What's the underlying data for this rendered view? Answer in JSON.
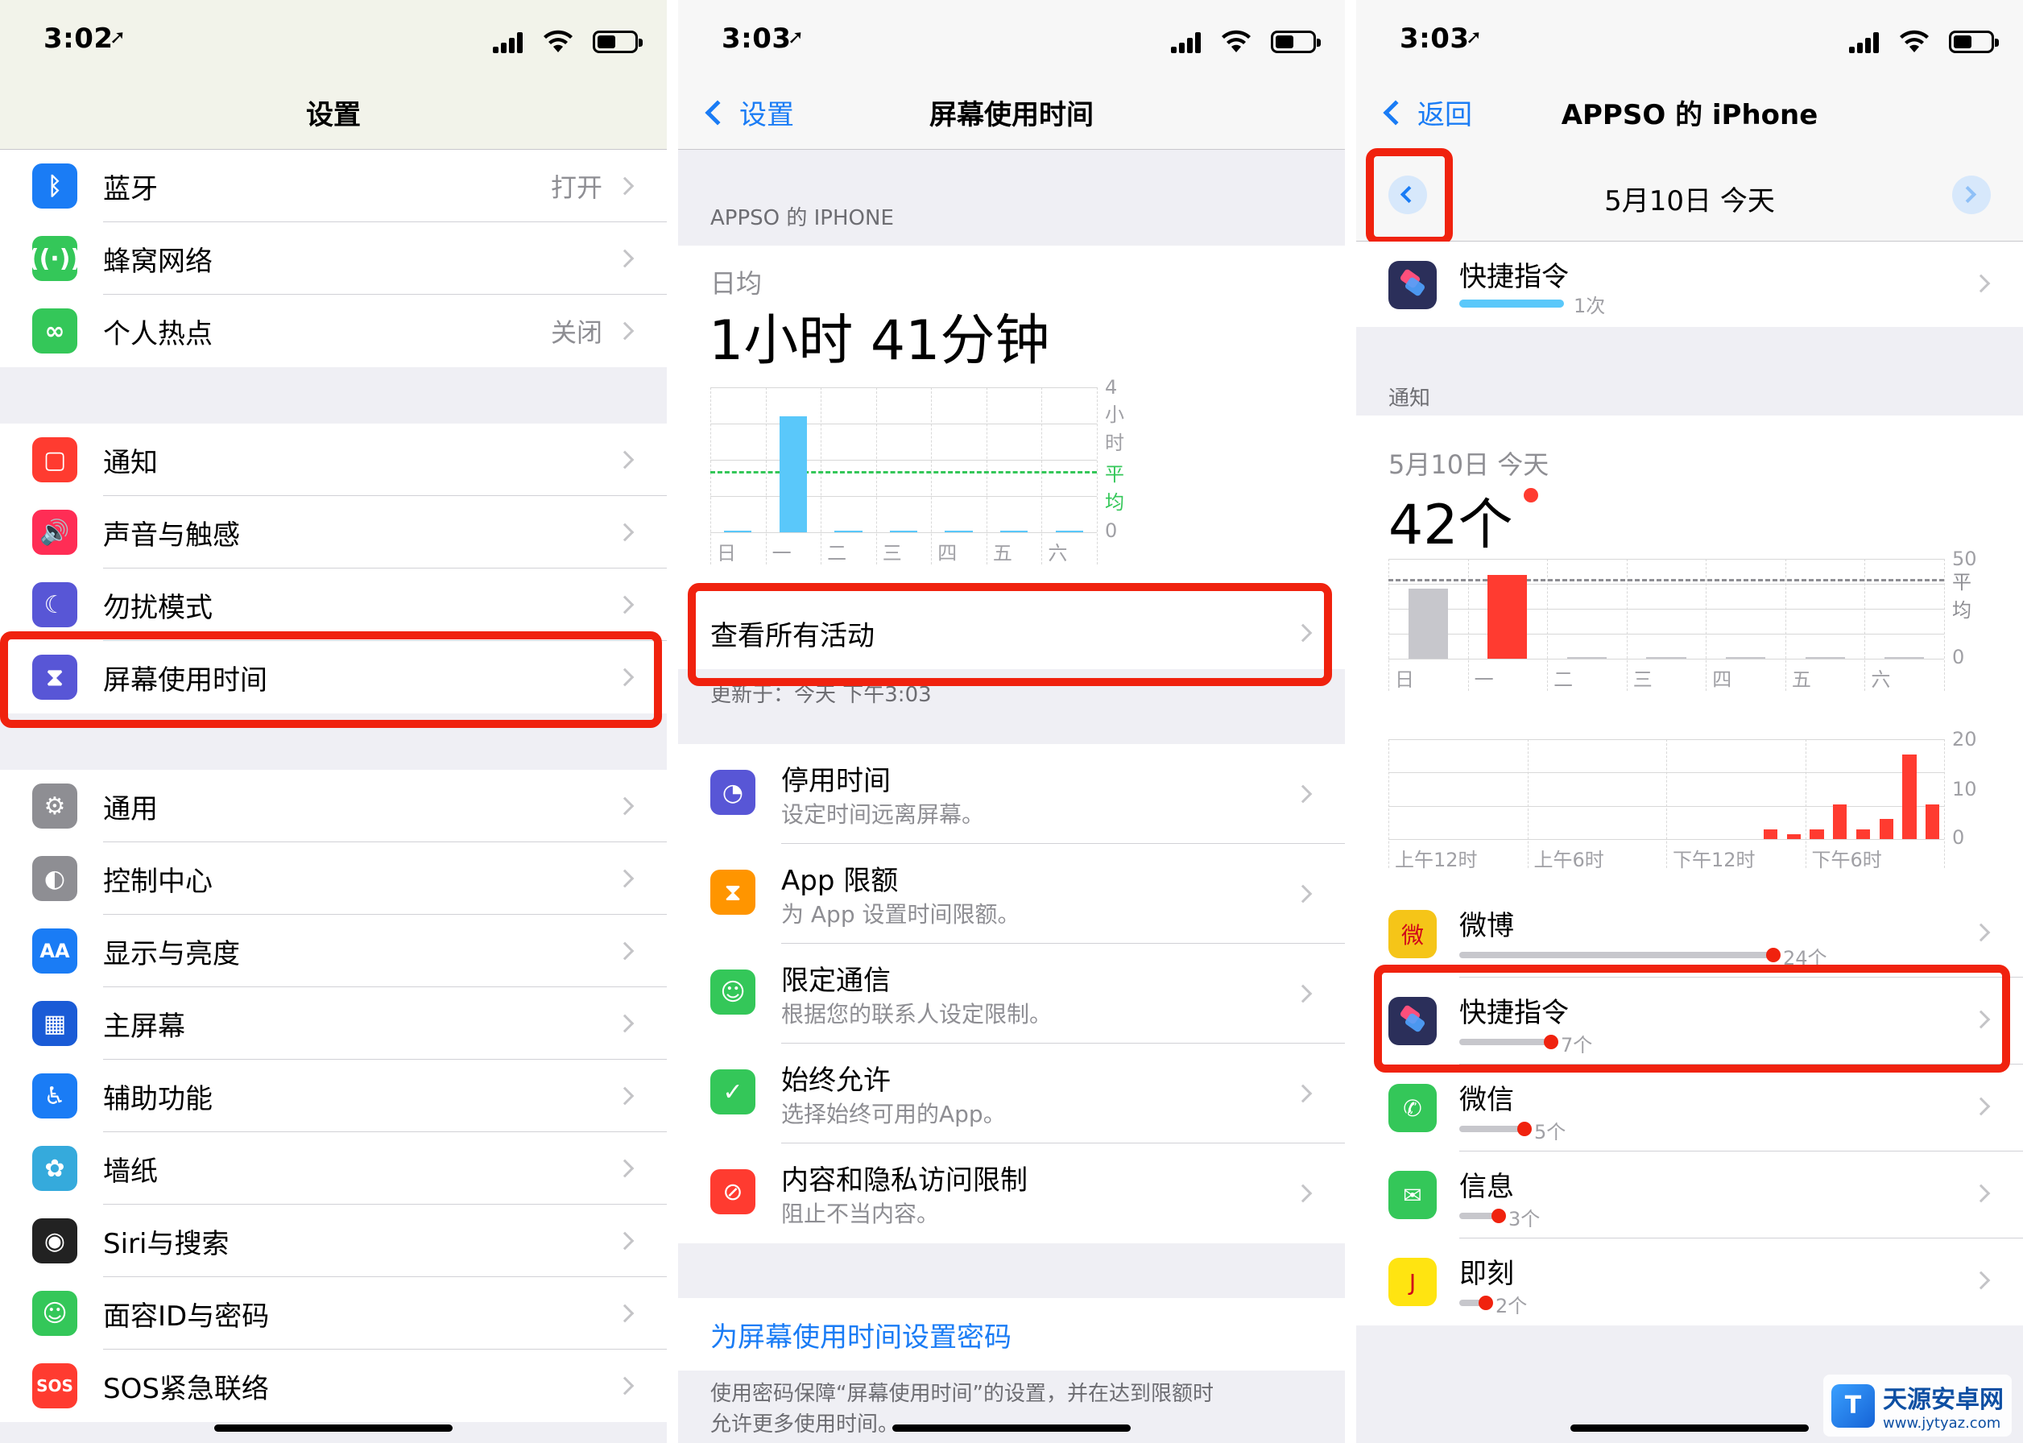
{
  "colors": {
    "accent": "#1a7cf5",
    "highlight": "#f0220e",
    "chart_blue": "#5ac8fa",
    "avg_green": "#34c759",
    "notify_red": "#ff3b30"
  },
  "status_bars": [
    {
      "time": "3:02"
    },
    {
      "time": "3:03"
    },
    {
      "time": "3:03"
    }
  ],
  "settings": {
    "title": "设置",
    "group1": [
      {
        "label": "蓝牙",
        "value": "打开",
        "icon": "bluetooth-icon",
        "color": "#1a7cf5"
      },
      {
        "label": "蜂窝网络",
        "value": "",
        "icon": "cellular-icon",
        "color": "#34c759"
      },
      {
        "label": "个人热点",
        "value": "关闭",
        "icon": "hotspot-icon",
        "color": "#34c759"
      }
    ],
    "group2": [
      {
        "label": "通知",
        "icon": "notifications-icon",
        "color": "#ff3b30"
      },
      {
        "label": "声音与触感",
        "icon": "sound-icon",
        "color": "#ff2d55"
      },
      {
        "label": "勿扰模式",
        "icon": "moon-icon",
        "color": "#5856d6"
      },
      {
        "label": "屏幕使用时间",
        "icon": "hourglass-icon",
        "color": "#5856d6"
      }
    ],
    "group3": [
      {
        "label": "通用",
        "icon": "gear-icon",
        "color": "#8e8e93"
      },
      {
        "label": "控制中心",
        "icon": "toggles-icon",
        "color": "#8e8e93"
      },
      {
        "label": "显示与亮度",
        "icon": "aa-icon",
        "color": "#1a7cf5"
      },
      {
        "label": "主屏幕",
        "icon": "home-grid-icon",
        "color": "#1a5bd6"
      },
      {
        "label": "辅助功能",
        "icon": "accessibility-icon",
        "color": "#1a7cf5"
      },
      {
        "label": "墙纸",
        "icon": "wallpaper-icon",
        "color": "#35aadc"
      },
      {
        "label": "Siri与搜索",
        "icon": "siri-icon",
        "color": "#222222"
      },
      {
        "label": "面容ID与密码",
        "icon": "faceid-icon",
        "color": "#34c759"
      },
      {
        "label": "SOS紧急联络",
        "icon": "sos-icon",
        "color": "#ff3b30"
      }
    ],
    "aa_glyph": "AA",
    "sos_glyph": "SOS"
  },
  "screen_time": {
    "back": "设置",
    "title": "屏幕使用时间",
    "section": "APPSO 的 IPHONE",
    "avg_label": "日均",
    "avg_value": "1小时 41分钟",
    "y_ticks": [
      "4小时",
      "平均",
      "0"
    ],
    "days": [
      "日",
      "一",
      "二",
      "三",
      "四",
      "五",
      "六"
    ],
    "view_all": "查看所有活动",
    "updated": "更新于：今天 下午3:03",
    "items": [
      {
        "title": "停用时间",
        "sub": "设定时间远离屏幕。",
        "icon": "downtime-icon",
        "color": "#5856d6"
      },
      {
        "title": "App 限额",
        "sub": "为 App 设置时间限额。",
        "icon": "hourglass-icon",
        "color": "#ff9500"
      },
      {
        "title": "限定通信",
        "sub": "根据您的联系人设定限制。",
        "icon": "contact-icon",
        "color": "#34c759"
      },
      {
        "title": "始终允许",
        "sub": "选择始终可用的App。",
        "icon": "checkmark-icon",
        "color": "#34c759"
      },
      {
        "title": "内容和隐私访问限制",
        "sub": "阻止不当内容。",
        "icon": "block-icon",
        "color": "#ff3b30"
      }
    ],
    "passcode_link": "为屏幕使用时间设置密码",
    "footer": "使用密码保障“屏幕使用时间”的设置，并在达到限额时允许更多使用时间。"
  },
  "device": {
    "back": "返回",
    "title": "APPSO 的 iPhone",
    "date": "5月10日 今天",
    "top_app": {
      "name": "快捷指令",
      "count": "1次"
    },
    "section": "通知",
    "notif_date": "5月10日 今天",
    "notif_count": "42个",
    "weekly_ticks": [
      "50",
      "平均",
      "0"
    ],
    "days": [
      "日",
      "一",
      "二",
      "三",
      "四",
      "五",
      "六"
    ],
    "hourly_ticks": [
      "20",
      "10",
      "0"
    ],
    "hours": [
      "上午12时",
      "上午6时",
      "下午12时",
      "下午6时"
    ],
    "apps": [
      {
        "name": "微博",
        "count": "24个",
        "icon": "weibo-icon",
        "color": "#f5c518"
      },
      {
        "name": "快捷指令",
        "count": "7个",
        "icon": "shortcuts-icon",
        "color": "#2b2f5a"
      },
      {
        "name": "微信",
        "count": "5个",
        "icon": "wechat-icon",
        "color": "#34c759"
      },
      {
        "name": "信息",
        "count": "3个",
        "icon": "messages-icon",
        "color": "#34c759"
      },
      {
        "name": "即刻",
        "count": "2个",
        "icon": "jike-icon",
        "color": "#ffe411"
      }
    ]
  },
  "chart_data": [
    {
      "type": "bar",
      "title": "日均",
      "categories": [
        "日",
        "一",
        "二",
        "三",
        "四",
        "五",
        "六"
      ],
      "values": [
        0.03,
        3.2,
        0,
        0,
        0,
        0,
        0
      ],
      "ylim": [
        0,
        4
      ],
      "avg_line": 1.68,
      "ylabel": "小时"
    },
    {
      "type": "bar",
      "categories": [
        "日",
        "一",
        "二",
        "三",
        "四",
        "五",
        "六"
      ],
      "values": [
        35,
        42,
        0,
        0,
        0,
        0,
        0
      ],
      "ylim": [
        0,
        50
      ],
      "avg_line": 40
    },
    {
      "type": "bar",
      "categories": [
        "0",
        "1",
        "2",
        "3",
        "4",
        "5",
        "6",
        "7",
        "8",
        "9",
        "10",
        "11",
        "12",
        "13",
        "14",
        "15",
        "16",
        "17",
        "18",
        "19",
        "20",
        "21",
        "22",
        "23"
      ],
      "values": [
        0,
        0,
        0,
        0,
        0,
        0,
        0,
        0,
        0,
        0,
        0,
        0,
        0,
        0,
        0,
        0,
        2,
        1,
        2,
        7,
        2,
        4,
        17,
        7
      ],
      "x_tick_labels": [
        "上午12时",
        "上午6时",
        "下午12时",
        "下午6时"
      ],
      "ylim": [
        0,
        20
      ]
    }
  ]
}
